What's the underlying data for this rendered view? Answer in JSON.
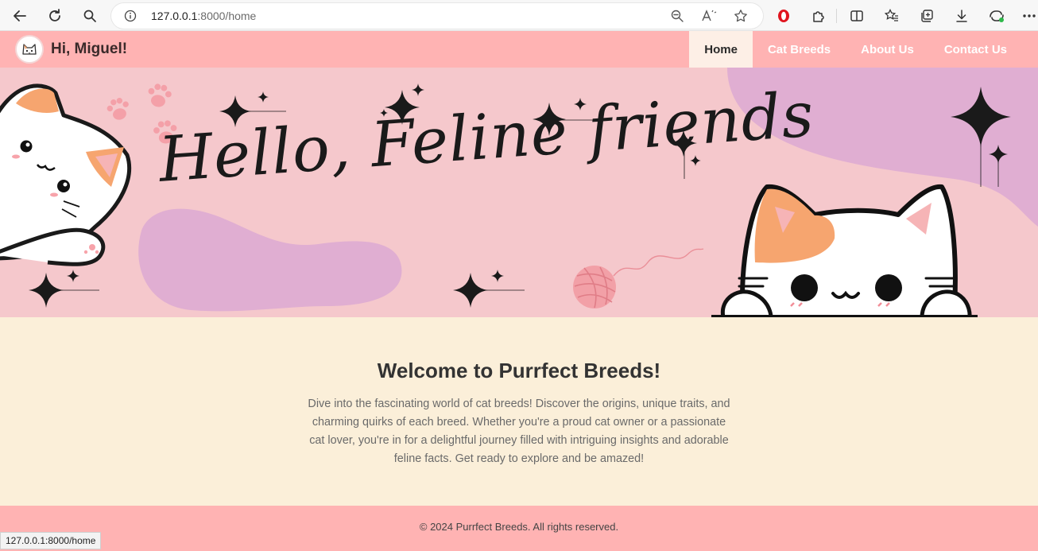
{
  "browser": {
    "url_host": "127.0.0.1",
    "url_rest": ":8000/home",
    "status_url": "127.0.0.1:8000/home"
  },
  "site": {
    "greeting": "Hi, Miguel!",
    "nav": [
      {
        "label": "Home",
        "active": true
      },
      {
        "label": "Cat Breeds",
        "active": false
      },
      {
        "label": "About Us",
        "active": false
      },
      {
        "label": "Contact Us",
        "active": false
      }
    ],
    "hero_text": "Hello, Feline friends",
    "welcome_title": "Welcome to Purrfect Breeds!",
    "welcome_text": "Dive into the fascinating world of cat breeds! Discover the origins, unique traits, and charming quirks of each breed. Whether you're a proud cat owner or a passionate cat lover, you're in for a delightful journey filled with intriguing insights and adorable feline facts. Get ready to explore and be amazed!",
    "footer": "© 2024 Purrfect Breeds. All rights reserved."
  },
  "colors": {
    "header": "#ffb3b3",
    "hero": "#f5c8cc",
    "blob": "#e0aed2",
    "cream": "#fbefd9",
    "active_tab": "#fdefe6"
  },
  "icons": [
    "back-icon",
    "reload-icon",
    "search-icon",
    "info-icon",
    "zoom-icon",
    "read-aloud-icon",
    "favorite-star-icon",
    "opera-icon",
    "extensions-icon",
    "split-screen-icon",
    "favorites-icon",
    "collections-icon",
    "download-icon",
    "copilot-icon",
    "more-icon"
  ]
}
